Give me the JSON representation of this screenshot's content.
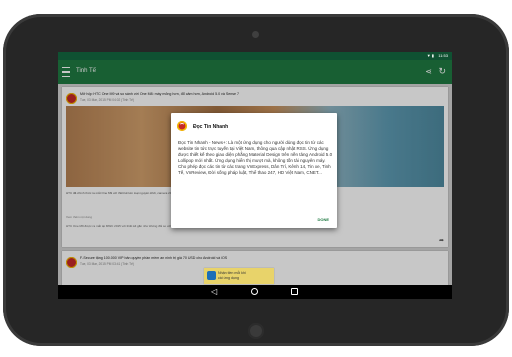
{
  "status_bar": {
    "time": "11:53",
    "icons": "▼ ▮"
  },
  "app_bar": {
    "title": "Tinh Tế"
  },
  "feed": [
    {
      "title": "Mở hộp HTC One M9 và so sánh với One M8: máy mỏng hơn, đổ cảm hơn, Android 5.0 và Sense 7",
      "time": "Tue, 03 Mar, 2015 PM 04:02 (Tinh Tế)",
      "snippet": "HTC đã chính thức ra mắt One M9 với thiết kế kim loại nguyên khối, camera 20MP phía sau và màn hình 5 inch Full HD.",
      "more": "Xem thêm nội dung",
      "snippet2": "HTC One M9 được ra mắt tại MWC 2015 với thiết kế gần như không đổi so với One M8 nhưng có nhiều cải tiến về phần cứng."
    },
    {
      "title": "F-Secure tặng 100.000 VIP bản quyền phần mềm an ninh trị giá 70 USD cho Android và iOS",
      "time": "Tue, 03 Mar, 2015 PM 03:41 (Tinh Tế)"
    }
  ],
  "dialog": {
    "title": "Đọc Tin Nhanh",
    "body": "Đọc Tin Nhanh - News+: Là một ứng dụng cho người dùng đọc tin từ các website tin tức trực tuyến tại Việt Nam, thông qua cập nhật RSS. Ứng dụng được thiết kế theo giao diện phẳng Material Design trên nền tảng Android 5.0 Lollipop mới nhất. Ứng dụng hiển thị mượt mà, không tốn tài nguyên máy. Cho phép đọc các tin từ các trang VnExpress, Dân Trí, Kênh 14, Tin xe, Tinh Tế, VnReview, Đời sống pháp luật, Thể thao 247, HD Việt Nam, CNET...",
    "ok": "DONE"
  },
  "ad": {
    "line1": "Nhận tiền mỗi khi",
    "line2": "cài ứng dụng"
  },
  "colors": {
    "app_bar": "#1f7a42",
    "status_bar": "#0f5132",
    "accent": "#1f7a42"
  }
}
